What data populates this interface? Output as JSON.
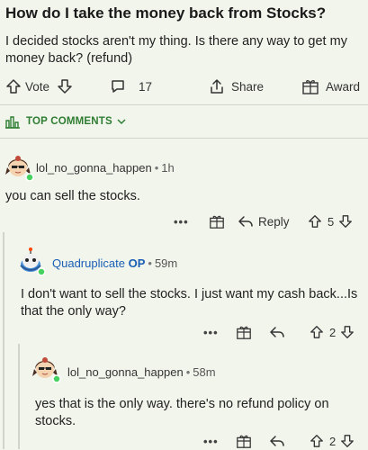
{
  "post": {
    "title": "How do I take the money back from Stocks?",
    "body": "I decided stocks aren't my thing. Is there any way to get my money back? (refund)",
    "vote_label": "Vote",
    "comment_count": "17",
    "share_label": "Share",
    "award_label": "Award"
  },
  "sort": {
    "label": "TOP COMMENTS"
  },
  "comments": [
    {
      "username": "lol_no_gonna_happen",
      "time": "1h",
      "text": "you can sell the stocks.",
      "more": "•••",
      "reply_label": "Reply",
      "score": "5"
    },
    {
      "username": "Quadruplicate",
      "op_badge": "OP",
      "time": "59m",
      "text": "I don't want to sell the stocks. I just want my cash back...Is that the only way?",
      "more": "•••",
      "score": "2"
    },
    {
      "username": "lol_no_gonna_happen",
      "time": "58m",
      "text": "yes that is the only way.  there's no refund policy on stocks.",
      "more": "•••",
      "score": "2"
    }
  ],
  "separator": "•"
}
